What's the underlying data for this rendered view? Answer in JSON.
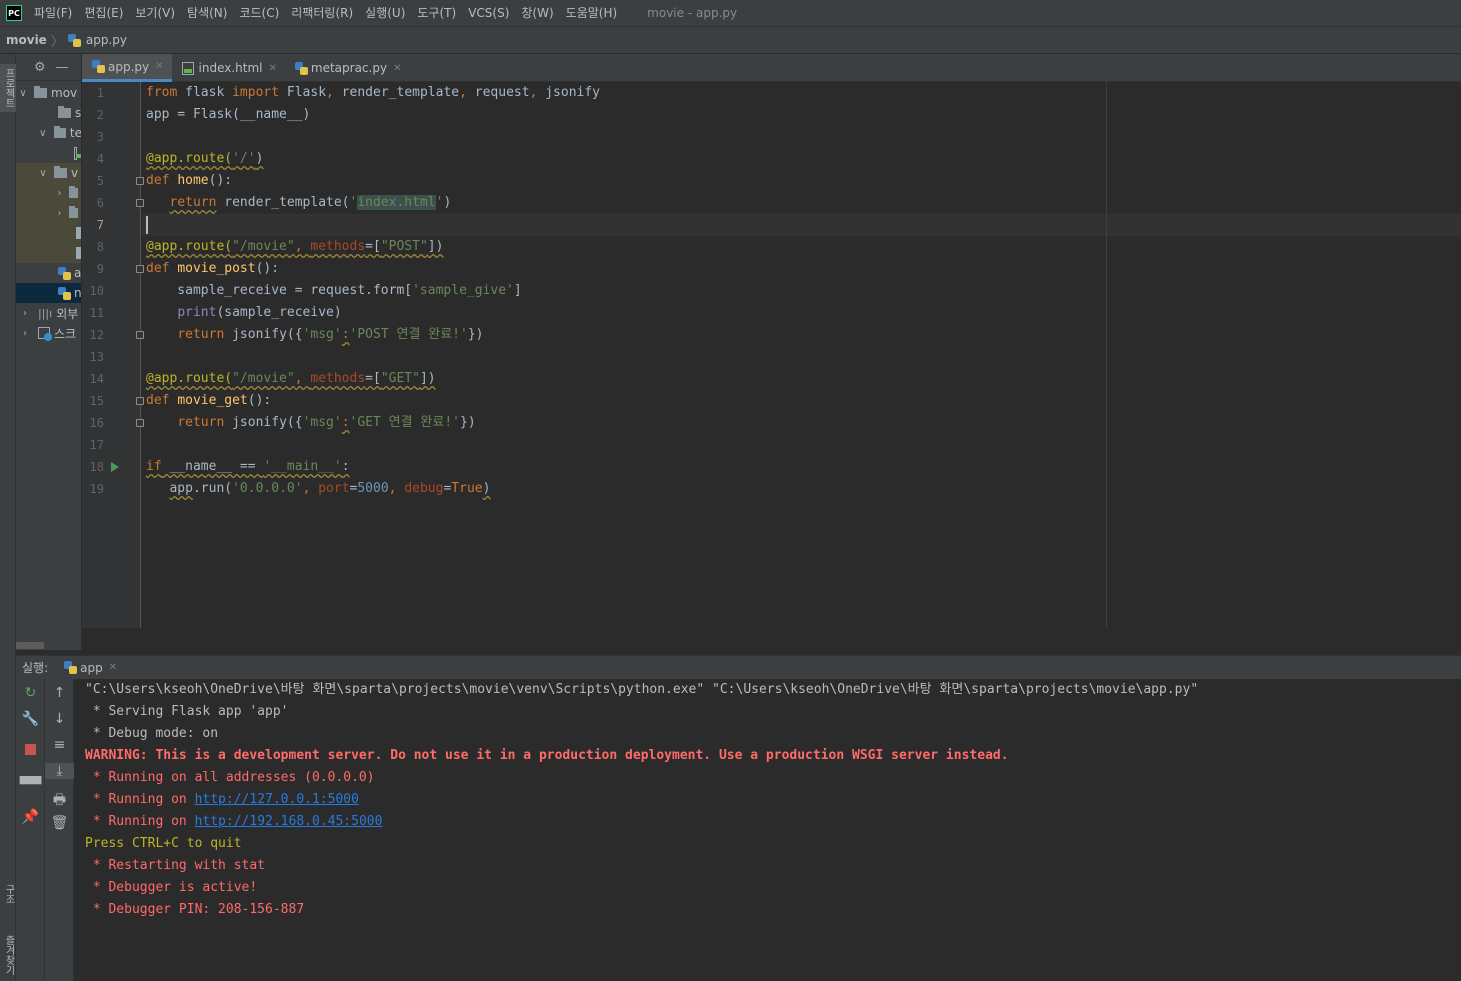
{
  "app": {
    "logo": "PC",
    "window_title": "movie - app.py"
  },
  "menu": [
    "파일(F)",
    "편집(E)",
    "보기(V)",
    "탐색(N)",
    "코드(C)",
    "리팩터링(R)",
    "실행(U)",
    "도구(T)",
    "VCS(S)",
    "창(W)",
    "도움말(H)"
  ],
  "breadcrumb": {
    "project": "movie",
    "file": "app.py"
  },
  "side_strip": {
    "top": "프로젝트",
    "mid": "구조",
    "bottom": "즐겨찾기"
  },
  "project_tree": [
    {
      "label": "mov",
      "arrow": "∨",
      "icon": "folder"
    },
    {
      "label": "s",
      "arrow": "",
      "icon": "folder"
    },
    {
      "label": "te",
      "arrow": "∨",
      "icon": "folder"
    },
    {
      "label": "",
      "arrow": "",
      "icon": "html"
    },
    {
      "label": "v",
      "arrow": "∨",
      "icon": "folder"
    },
    {
      "label": "",
      "arrow": "›",
      "icon": "folder"
    },
    {
      "label": "",
      "arrow": "›",
      "icon": "folder"
    },
    {
      "label": "",
      "arrow": "",
      "icon": "file"
    },
    {
      "label": "",
      "arrow": "",
      "icon": "file"
    },
    {
      "label": "a",
      "arrow": "",
      "icon": "py"
    },
    {
      "label": "n",
      "arrow": "",
      "icon": "py"
    },
    {
      "label": "외부",
      "arrow": "›",
      "icon": "lib"
    },
    {
      "label": "스크",
      "arrow": "›",
      "icon": "scratch"
    }
  ],
  "tabs": [
    {
      "label": "app.py",
      "icon": "py",
      "active": true
    },
    {
      "label": "index.html",
      "icon": "html",
      "active": false
    },
    {
      "label": "metaprac.py",
      "icon": "py",
      "active": false
    }
  ],
  "editor": {
    "line_numbers": [
      "1",
      "2",
      "3",
      "4",
      "5",
      "6",
      "7",
      "8",
      "9",
      "10",
      "11",
      "12",
      "13",
      "14",
      "15",
      "16",
      "17",
      "18",
      "19"
    ],
    "current_line": 7
  },
  "run_panel": {
    "label": "실행:",
    "tab": "app",
    "console": [
      {
        "text": "\"C:\\Users\\kseoh\\OneDrive\\바탕 화면\\sparta\\projects\\movie\\venv\\Scripts\\python.exe\" \"C:\\Users\\kseoh\\OneDrive\\바탕 화면\\sparta\\projects\\movie\\app.py\"",
        "style": "normal"
      },
      {
        "text": " * Serving Flask app 'app'",
        "style": "normal"
      },
      {
        "text": " * Debug mode: on",
        "style": "normal"
      },
      {
        "text": "WARNING: This is a development server. Do not use it in a production deployment. Use a production WSGI server instead.",
        "style": "red-bold"
      },
      {
        "text": " * Running on all addresses (0.0.0.0)",
        "style": "red"
      },
      {
        "prefix": " * Running on ",
        "link": "http://127.0.0.1:5000",
        "style": "red"
      },
      {
        "prefix": " * Running on ",
        "link": "http://192.168.0.45:5000",
        "style": "red"
      },
      {
        "text": "Press CTRL+C to quit",
        "style": "yellow"
      },
      {
        "text": " * Restarting with stat",
        "style": "red"
      },
      {
        "text": " * Debugger is active!",
        "style": "red"
      },
      {
        "text": " * Debugger PIN: 208-156-887",
        "style": "red"
      }
    ]
  },
  "colors": {
    "accent": "#4a88c7",
    "keyword": "#cc7832",
    "string": "#6a8759",
    "number": "#6897bb",
    "decorator": "#bbb529",
    "error": "#ff6b68",
    "link": "#287bde"
  },
  "code": {
    "l1_from": "from",
    "l1_mod": " flask ",
    "l1_import": "import",
    "l1_names": " Flask",
    "l1_c1": ",",
    "l1_n2": " render_template",
    "l1_c2": ",",
    "l1_n3": " request",
    "l1_c3": ",",
    "l1_n4": " jsonify",
    "l2": "app = Flask(__name__)",
    "l4_dec": "@app.route(",
    "l4_str": "'/'",
    "l4_end": ")",
    "l5_def": "def ",
    "l5_fn": "home",
    "l5_end": "():",
    "l6_indent": "   ",
    "l6_ret": "return",
    "l6_call": " render_template(",
    "l6_q1": "'",
    "l6_str": "index.html",
    "l6_q2": "'",
    "l6_end": ")",
    "l8_dec": "@app.route(",
    "l8_str": "\"/movie\"",
    "l8_c": ", ",
    "l8_param": "methods",
    "l8_eq": "=[",
    "l8_val": "\"POST\"",
    "l8_end": "])",
    "l9_def": "def ",
    "l9_fn": "movie_post",
    "l9_end": "():",
    "l10": "    sample_receive = request.form[",
    "l10_str": "'sample_give'",
    "l10_end": "]",
    "l11_indent": "    ",
    "l11_print": "print",
    "l11_end": "(sample_receive)",
    "l12_indent": "    ",
    "l12_ret": "return",
    "l12_call": " jsonify({",
    "l12_k": "'msg'",
    "l12_colon": ":",
    "l12_v": "'POST 연결 완료!'",
    "l12_end": "})",
    "l14_dec": "@app.route(",
    "l14_str": "\"/movie\"",
    "l14_c": ", ",
    "l14_param": "methods",
    "l14_eq": "=[",
    "l14_val": "\"GET\"",
    "l14_end": "])",
    "l15_def": "def ",
    "l15_fn": "movie_get",
    "l15_end": "():",
    "l16_indent": "    ",
    "l16_ret": "return",
    "l16_call": " jsonify({",
    "l16_k": "'msg'",
    "l16_colon": ":",
    "l16_v": "'GET 연결 완료!'",
    "l16_end": "})",
    "l18_if": "if",
    "l18_mid": " __name__ == ",
    "l18_str": "'__main__'",
    "l18_end": ":",
    "l19_indent": "   ",
    "l19_app": "app",
    "l19_call": ".run(",
    "l19_host": "'0.0.0.0'",
    "l19_c1": ", ",
    "l19_port": "port",
    "l19_eq1": "=",
    "l19_pnum": "5000",
    "l19_c2": ", ",
    "l19_debug": "debug",
    "l19_eq2": "=",
    "l19_true": "True",
    "l19_end": ")"
  }
}
